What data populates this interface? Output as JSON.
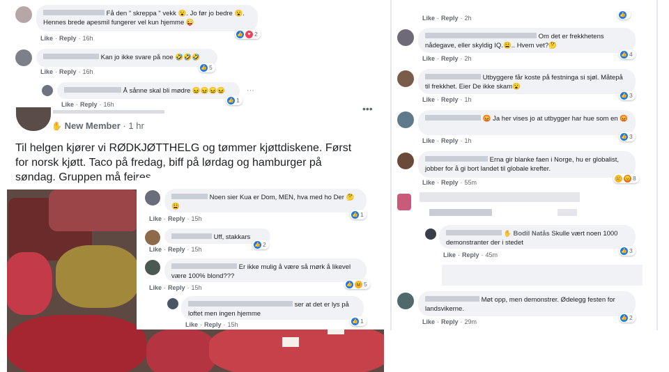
{
  "left_top_comments": [
    {
      "text": "Få den \" skreppa \" vekk 😮. Jo før jo bedre 😮. Hennes brede apesmil fungerer vel kun hjemme 😜",
      "time": "16h",
      "reactions": "2"
    },
    {
      "text": "Kan jo ikke svare på noe 🤣🤣🤣",
      "time": "16h",
      "reactions": "5"
    },
    {
      "text": "Å sånne skal bli mødre 😖😖😖😖",
      "time": "16h",
      "reactions": "1",
      "more": "···"
    }
  ],
  "post": {
    "badge": "New Member",
    "time": "1 hr",
    "more": "•••",
    "body": "Til helgen kjører vi RØDKJØTTHELG og tømmer kjøttdiskene. Først for norsk kjøtt. Taco på fredag, biff på lørdag og hamburger på søndag. Gruppen må feires."
  },
  "overlay_comments": [
    {
      "text": "Noen sier Kua er Dom, MEN, hva med ho Der 🤔😩",
      "time": "15h",
      "reactions": "1"
    },
    {
      "text": "Uff, stakkars",
      "time": "15h",
      "reactions": "2"
    },
    {
      "text": "Er ikke mulig å være så mørk å likevel være 100% blond???",
      "time": "15h",
      "reactions": "5"
    },
    {
      "text": "ser at det er lys på loftet men ingen hjemme",
      "time": "15h",
      "reactions": "1"
    }
  ],
  "right_comments": [
    {
      "time": "2h",
      "text": "",
      "reactions": ""
    },
    {
      "text": "Om det er frekkhetens nådegave, eller skyldig IQ.😩.. Hvem vet?🤔",
      "time": "2h",
      "reactions": "4"
    },
    {
      "text": "Utbyggere får koste på festninga si sjøl. Måtepå til frekkhet. Eier De ikke skam😮",
      "time": "1h",
      "reactions": "3"
    },
    {
      "text": "😡 Ja her vises jo at utbygger har hue som en 😡",
      "time": "1h",
      "reactions": "3"
    },
    {
      "text": "Erna gir blanke faen i Norge, hu er globalist, jobber for å gi bort landet til globale krefter.",
      "time": "55m",
      "reactions": "8"
    },
    {
      "name": "Bodil Natås",
      "text": "Skulle vært noen 1000 demonstranter der i stedet",
      "time": "45m",
      "reactions": "3"
    },
    {
      "text": "Møt opp, men demonstrer. Ødelegg festen for landsvikerne.",
      "time": "29m",
      "reactions": "2"
    }
  ],
  "labels": {
    "like": "Like",
    "reply": "Reply",
    "dot": "·"
  }
}
